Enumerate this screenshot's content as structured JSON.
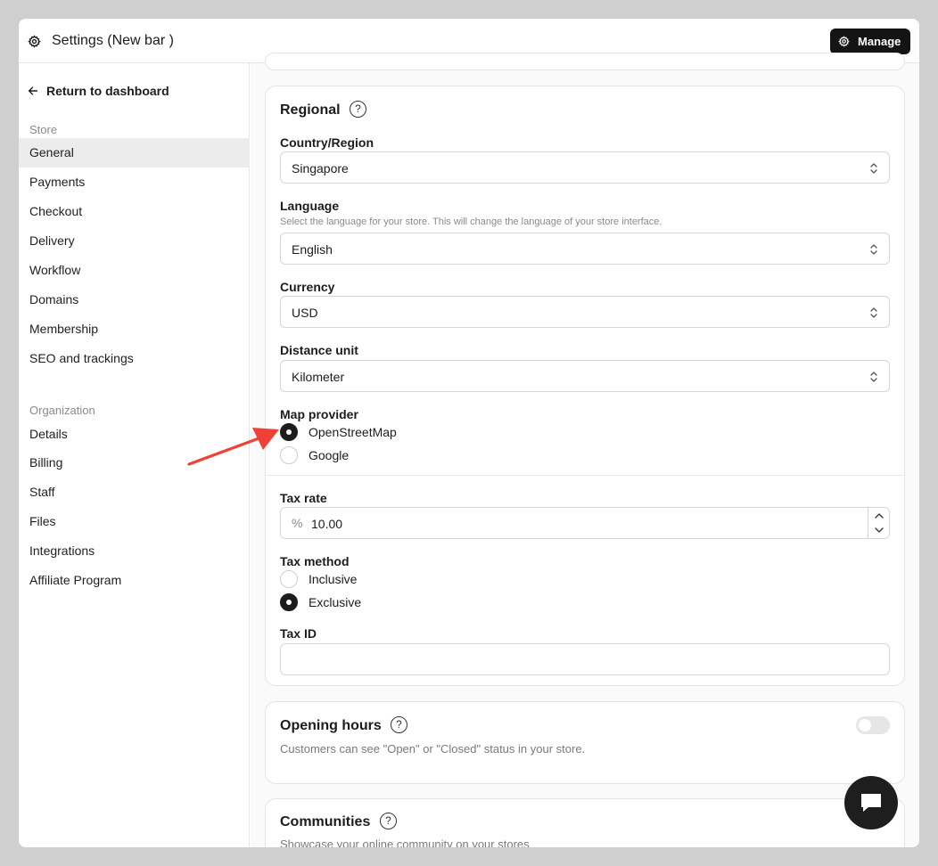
{
  "header": {
    "title": "Settings (New bar )",
    "manage_label": "Manage"
  },
  "sidebar": {
    "back_label": "Return to dashboard",
    "store_label": "Store",
    "store_items": [
      "General",
      "Payments",
      "Checkout",
      "Delivery",
      "Workflow",
      "Domains",
      "Membership",
      "SEO and trackings"
    ],
    "org_label": "Organization",
    "org_items": [
      "Details",
      "Billing",
      "Staff",
      "Files",
      "Integrations",
      "Affiliate Program"
    ],
    "active": "General"
  },
  "regional": {
    "title": "Regional",
    "help": "?",
    "country_label": "Country/Region",
    "country_value": "Singapore",
    "language_label": "Language",
    "language_desc": "Select the language for your store. This will change the language of your store interface.",
    "language_value": "English",
    "currency_label": "Currency",
    "currency_value": "USD",
    "distance_label": "Distance unit",
    "distance_value": "Kilometer",
    "map_label": "Map provider",
    "map_options": [
      "OpenStreetMap",
      "Google"
    ],
    "map_selected": "OpenStreetMap",
    "taxrate_label": "Tax rate",
    "taxrate_prefix": "%",
    "taxrate_value": "10.00",
    "taxmethod_label": "Tax method",
    "taxmethod_options": [
      "Inclusive",
      "Exclusive"
    ],
    "taxmethod_selected": "Exclusive",
    "taxid_label": "Tax ID",
    "taxid_value": ""
  },
  "opening_hours": {
    "title": "Opening hours",
    "help": "?",
    "desc": "Customers can see \"Open\" or \"Closed\" status in your store.",
    "enabled": false
  },
  "communities": {
    "title": "Communities",
    "help": "?",
    "desc": "Showcase your online community on your stores"
  },
  "colors": {
    "accent": "#141414",
    "active_bg": "#ececec",
    "annotation_arrow": "#ef4135"
  }
}
